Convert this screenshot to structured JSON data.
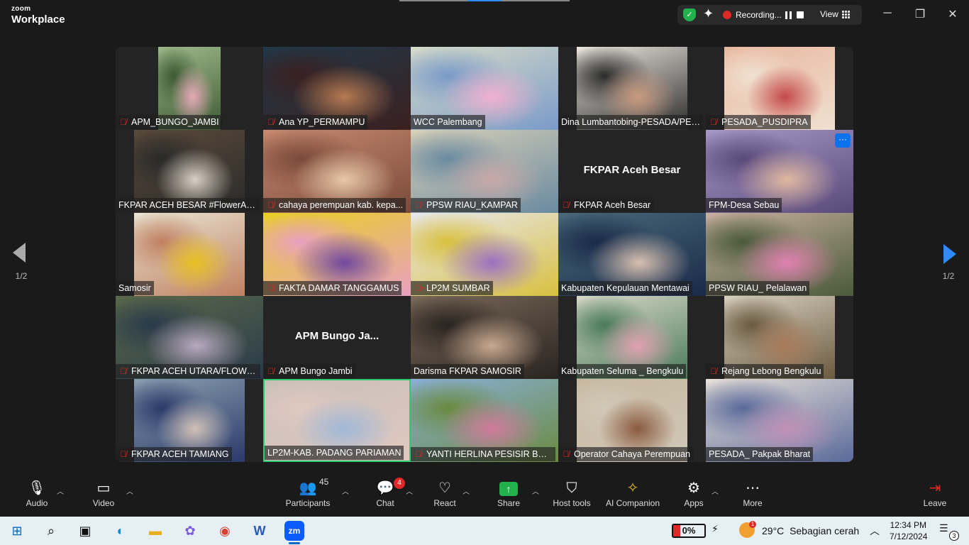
{
  "app": {
    "brand_top": "zoom",
    "brand_name": "Workplace"
  },
  "status_bar": {
    "recording_label": "Recording...",
    "view_label": "View"
  },
  "window_controls": {
    "minimize": "─",
    "restore": "❐",
    "close": "✕"
  },
  "pager": {
    "left_label": "1/2",
    "right_label": "1/2"
  },
  "tiles": [
    {
      "name": "APM_BUNGO_JAMBI",
      "muted": true,
      "video": "narrow",
      "colors": [
        "#9fb98a",
        "#e6a8b8",
        "#3c5a34"
      ]
    },
    {
      "name": "Ana YP_PERMAMPU",
      "muted": true,
      "video": "full",
      "colors": [
        "#203848",
        "#b77a52",
        "#3a2020"
      ]
    },
    {
      "name": "WCC Palembang",
      "muted": false,
      "video": "full",
      "colors": [
        "#d8dcc8",
        "#f0b0d0",
        "#7a9ac8"
      ]
    },
    {
      "name": "Dina Lumbantobing-PESADA/PER...",
      "muted": false,
      "video": "portrait",
      "colors": [
        "#eae6de",
        "#c89a80",
        "#2c2c2c"
      ]
    },
    {
      "name": "PESADA_PUSDIPRA",
      "muted": true,
      "video": "portrait",
      "colors": [
        "#e8b8a0",
        "#c44a4a",
        "#f0e0d0"
      ]
    },
    {
      "name": "FKPAR ACEH BESAR #FlowerAceh...",
      "muted": false,
      "video": "portrait",
      "colors": [
        "#5a4a3a",
        "#d8d0c4",
        "#2a2a2a"
      ]
    },
    {
      "name": "cahaya perempuan kab. kepa...",
      "muted": true,
      "video": "full",
      "colors": [
        "#c88a70",
        "#e8c8a8",
        "#7a4a3a"
      ]
    },
    {
      "name": "PPSW RIAU_KAMPAR",
      "muted": true,
      "video": "full",
      "colors": [
        "#d8d0b8",
        "#c8a8a8",
        "#6a8aa0"
      ]
    },
    {
      "name": "FKPAR Aceh Besar",
      "muted": true,
      "video": "none",
      "placeholder": "FKPAR Aceh Besar",
      "colors": [
        "#242424",
        "#242424",
        "#242424"
      ]
    },
    {
      "name": "FPM-Desa Sebau",
      "muted": false,
      "video": "full",
      "colors": [
        "#a898c8",
        "#e0b8a0",
        "#5a4a7a"
      ],
      "more": true
    },
    {
      "name": "Samosir",
      "muted": false,
      "video": "portrait",
      "colors": [
        "#e8e4d4",
        "#e8c020",
        "#c08060"
      ]
    },
    {
      "name": "FAKTA DAMAR TANGGAMUS",
      "muted": true,
      "video": "full",
      "colors": [
        "#e8d020",
        "#7048a0",
        "#e8a0c0"
      ]
    },
    {
      "name": "LP2M SUMBAR",
      "muted": true,
      "video": "full",
      "colors": [
        "#e8e8f0",
        "#9a70c0",
        "#d8c040"
      ]
    },
    {
      "name": "Kabupaten Kepulauan Mentawai",
      "muted": false,
      "video": "full",
      "colors": [
        "#4a6a7a",
        "#d8c0b0",
        "#1a2a4a"
      ]
    },
    {
      "name": "PPSW RIAU_ Pelalawan",
      "muted": false,
      "video": "full",
      "colors": [
        "#c8b0a0",
        "#e080b0",
        "#4a5a3a"
      ]
    },
    {
      "name": "FKPAR ACEH UTARA/FLOWER ...",
      "muted": true,
      "video": "full",
      "colors": [
        "#5a6a4a",
        "#b8a8c0",
        "#2a3a4a"
      ]
    },
    {
      "name": "APM Bungo Jambi",
      "muted": true,
      "video": "none",
      "placeholder": "APM Bungo Ja...",
      "colors": [
        "#242424",
        "#242424",
        "#242424"
      ]
    },
    {
      "name": "Darisma FKPAR SAMOSIR",
      "muted": false,
      "video": "full",
      "colors": [
        "#7a6a5a",
        "#c8a890",
        "#2a2420"
      ]
    },
    {
      "name": "Kabupaten Seluma _ Bengkulu",
      "muted": false,
      "video": "portrait",
      "colors": [
        "#d8d8c8",
        "#e0a0b0",
        "#4a7a5a"
      ]
    },
    {
      "name": "Rejang Lebong Bengkulu",
      "muted": true,
      "video": "portrait",
      "colors": [
        "#d8d0c0",
        "#a87a5a",
        "#6a5a40"
      ]
    },
    {
      "name": "FKPAR ACEH TAMIANG",
      "muted": true,
      "video": "portrait",
      "colors": [
        "#8aa0b0",
        "#d0c0b8",
        "#2a3a6a"
      ]
    },
    {
      "name": "LP2M-KAB. PADANG PARIAMAN",
      "muted": false,
      "video": "full",
      "colors": [
        "#c8c0b8",
        "#a0b8d8",
        "#e0c8c0"
      ],
      "speaking": true
    },
    {
      "name": "YANTI HERLINA PESISIR BARAT",
      "muted": true,
      "video": "full",
      "colors": [
        "#8ab0d8",
        "#d07a9a",
        "#6a8a40"
      ]
    },
    {
      "name": "Operator Cahaya Perempuan",
      "muted": true,
      "video": "portrait",
      "colors": [
        "#c8b8a0",
        "#8a5a40",
        "#d0c8b8"
      ]
    },
    {
      "name": "PESADA_ Pakpak Bharat",
      "muted": false,
      "video": "full",
      "colors": [
        "#e8e0d8",
        "#c090b8",
        "#5a6a9a"
      ]
    }
  ],
  "toolbar": {
    "audio": "Audio",
    "video": "Video",
    "participants": "Participants",
    "participants_count": "45",
    "chat": "Chat",
    "chat_badge": "4",
    "react": "React",
    "share": "Share",
    "host_tools": "Host tools",
    "ai_companion": "AI Companion",
    "apps": "Apps",
    "more": "More",
    "leave": "Leave"
  },
  "taskbar": {
    "battery": "0%",
    "weather_temp": "29°C",
    "weather_desc": "Sebagian cerah",
    "weather_badge": "1",
    "time": "12:34 PM",
    "date": "7/12/2024",
    "notifications": "3"
  }
}
